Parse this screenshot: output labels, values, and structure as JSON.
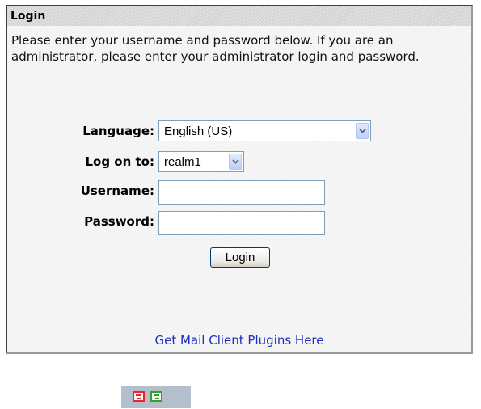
{
  "panel": {
    "title": "Login",
    "intro": "Please enter your username and password below. If you are an administrator, please enter your administrator login and password."
  },
  "form": {
    "language": {
      "label": "Language:",
      "selected": "English (US)"
    },
    "realm": {
      "label": "Log on to:",
      "selected": "realm1"
    },
    "username": {
      "label": "Username:",
      "value": ""
    },
    "password": {
      "label": "Password:",
      "value": ""
    },
    "submit_label": "Login"
  },
  "links": {
    "plugins": "Get Mail Client Plugins Here"
  },
  "mini_toolbar": {
    "icons": [
      "red-envelope-icon",
      "green-envelope-icon"
    ],
    "colors": {
      "red": "#e8262b",
      "green": "#31a02f"
    }
  },
  "colors": {
    "link": "#1f2fbf",
    "header_bg": "#d4d4d4",
    "panel_bg": "#f2f2f2"
  }
}
